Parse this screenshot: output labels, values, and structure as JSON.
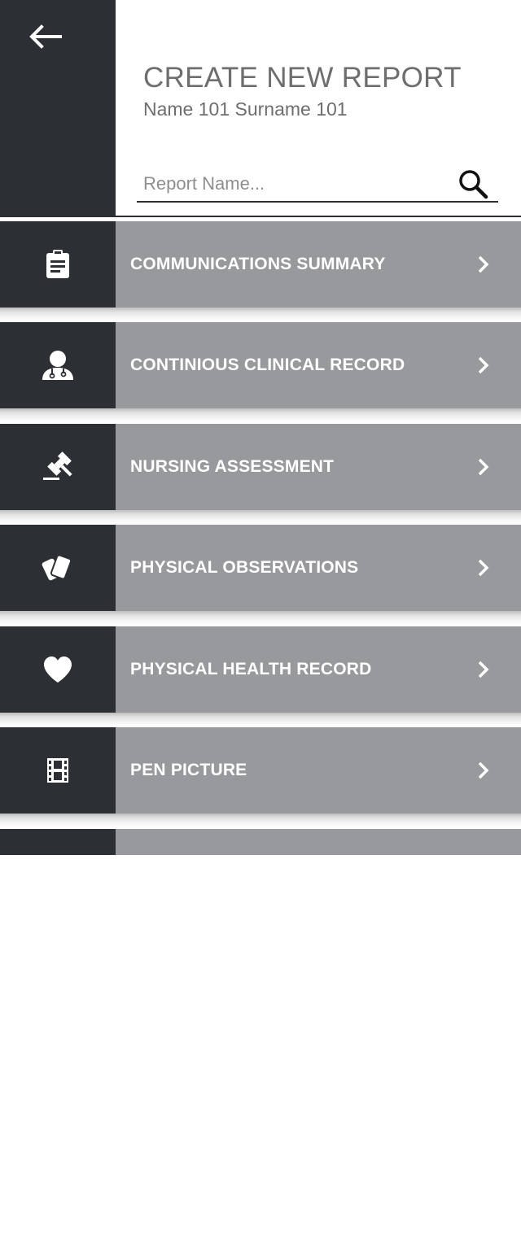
{
  "header": {
    "title": "CREATE NEW REPORT",
    "subtitle": "Name 101 Surname 101",
    "search": {
      "placeholder": "Report Name...",
      "value": ""
    }
  },
  "colors": {
    "dark": "#2c2f34",
    "item_bg": "#98999d",
    "text_gray": "#6e6e70"
  },
  "menu": {
    "items": [
      {
        "label": "COMMUNICATIONS SUMMARY",
        "icon": "clipboard-icon"
      },
      {
        "label": "CONTINIOUS CLINICAL RECORD",
        "icon": "doctor-icon"
      },
      {
        "label": "NURSING ASSESSMENT",
        "icon": "gavel-icon"
      },
      {
        "label": "PHYSICAL OBSERVATIONS",
        "icon": "cards-icon"
      },
      {
        "label": "PHYSICAL HEALTH RECORD",
        "icon": "heart-icon"
      },
      {
        "label": "PEN PICTURE",
        "icon": "film-icon"
      },
      {
        "label": "",
        "icon": ""
      }
    ]
  }
}
